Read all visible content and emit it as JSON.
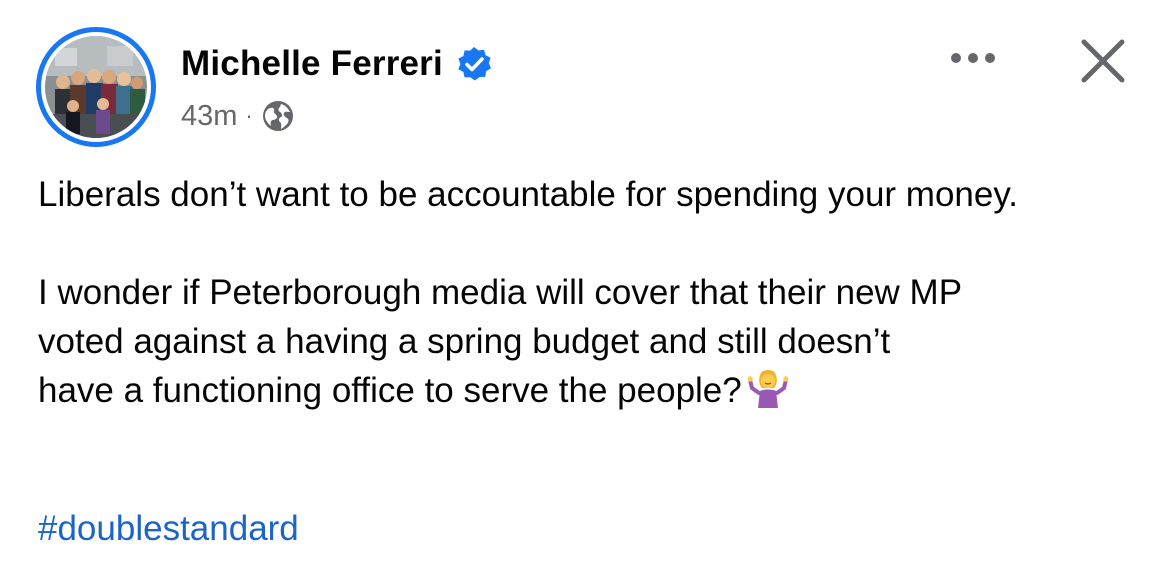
{
  "post": {
    "author": {
      "name": "Michelle Ferreri",
      "verified": true,
      "avatar_icon": "group-photo-avatar"
    },
    "meta": {
      "timestamp": "43m",
      "separator": "·",
      "audience_icon": "globe-icon"
    },
    "actions": {
      "more_icon": "more-horizontal-icon",
      "close_icon": "close-icon"
    },
    "body": {
      "paragraph_1": "Liberals don’t want to be accountable for spending your money.",
      "paragraph_2_line_1": "I wonder if Peterborough media will cover that their new MP",
      "paragraph_2_line_2": "voted against a having a spring budget and still doesn’t",
      "paragraph_2_line_3": "have a functioning office to serve the people?",
      "emoji": "woman-shrugging-emoji"
    },
    "hashtag": "#doublestandard"
  },
  "colors": {
    "accent_blue": "#1877f2",
    "link_blue": "#1b65c6",
    "text": "#050505",
    "secondary_text": "#65676b"
  }
}
